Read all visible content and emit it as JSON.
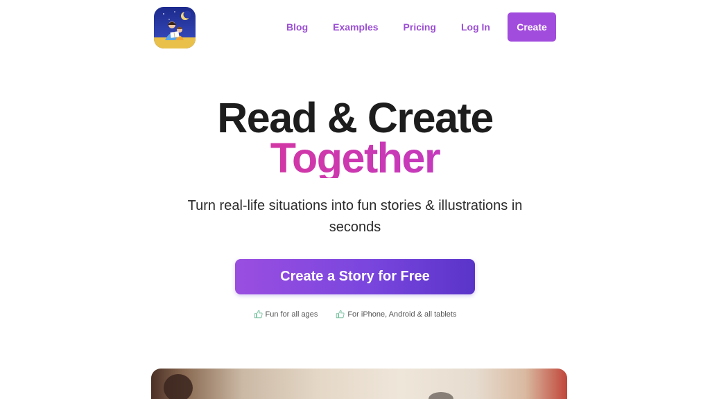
{
  "header": {
    "logo_icon": "parent-reading-to-child-icon",
    "nav": {
      "blog": "Blog",
      "examples": "Examples",
      "pricing": "Pricing",
      "login": "Log In",
      "create": "Create"
    }
  },
  "hero": {
    "title_line1": "Read & Create",
    "title_line2": "Together",
    "subtitle": "Turn real-life situations into fun stories & illustrations in seconds",
    "cta_label": "Create a Story for Free",
    "badges": [
      {
        "icon": "thumbs-up-icon",
        "label": "Fun for all ages"
      },
      {
        "icon": "thumbs-up-icon",
        "label": "For iPhone, Android & all tablets"
      }
    ]
  },
  "colors": {
    "accent": "#a24cdd",
    "nav_link": "#9b4fd3",
    "gradient_pink": "#e8327c",
    "gradient_purple": "#a847da",
    "cta_start": "#9a4ee0",
    "cta_end": "#5a34c9"
  }
}
